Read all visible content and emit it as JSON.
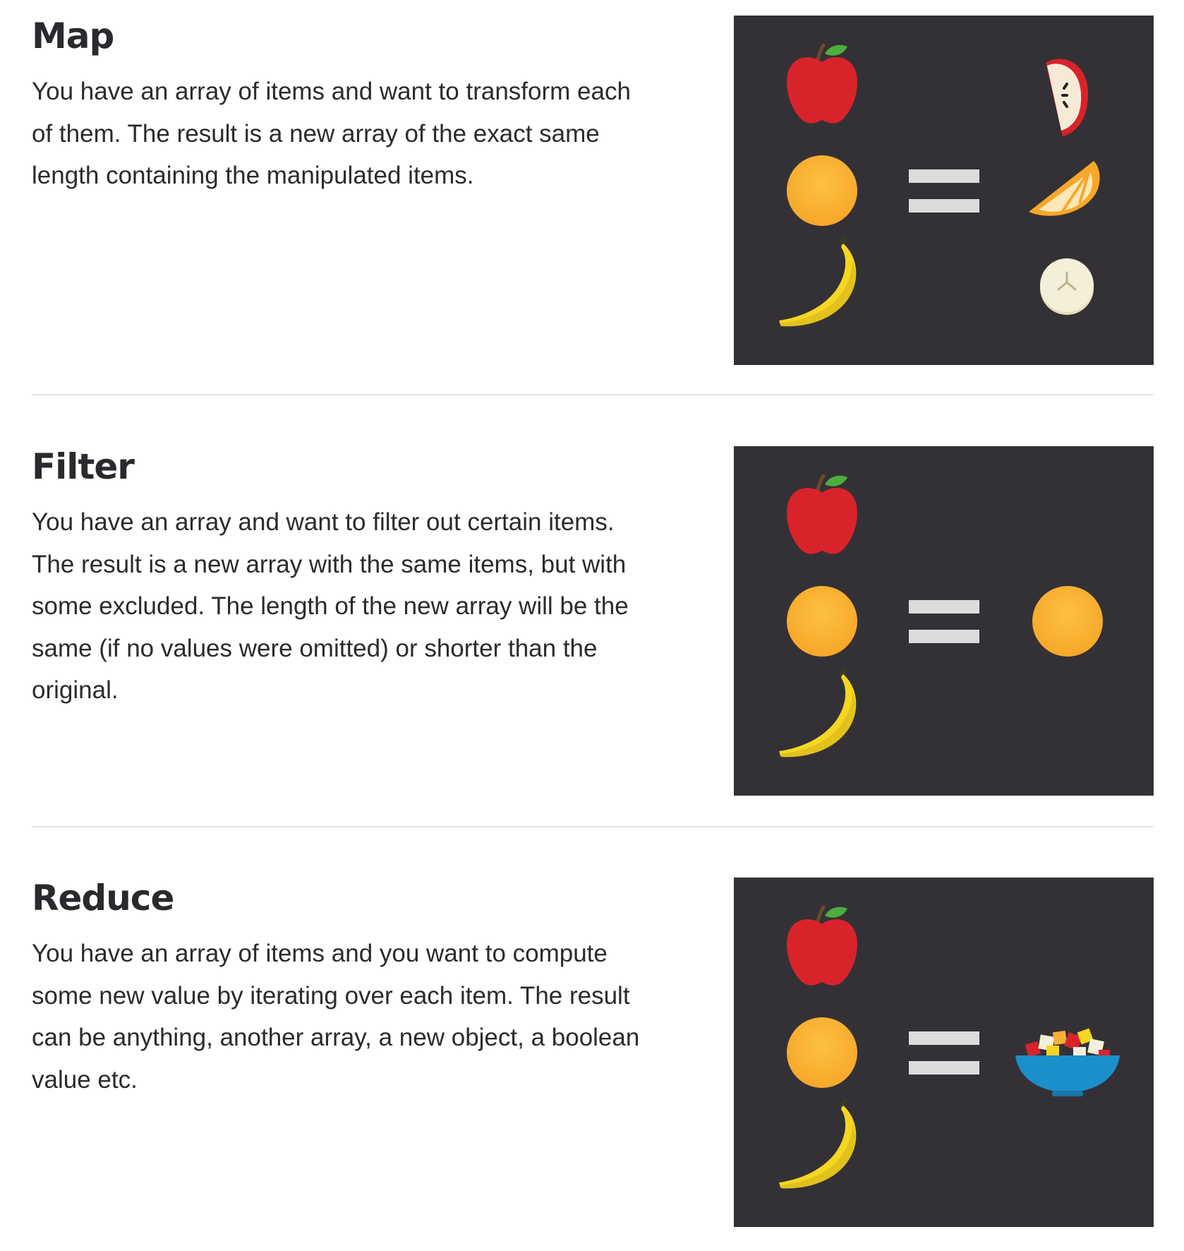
{
  "sections": [
    {
      "title": "Map",
      "description": "You have an array of items and want to transform each of them. The result is a new array of the exact same length containing the manipulated items.",
      "diagram": {
        "inputs": [
          "apple-icon",
          "orange-icon",
          "banana-icon"
        ],
        "operator": "equals-icon",
        "outputs": [
          "apple-slice-icon",
          "orange-wedge-icon",
          "banana-slice-icon"
        ]
      }
    },
    {
      "title": "Filter",
      "description": "You have an array and want to filter out certain items. The result is a new array with the same items, but with some excluded. The length of the new array will be the same (if no values were omitted) or shorter than the original.",
      "diagram": {
        "inputs": [
          "apple-icon",
          "orange-icon",
          "banana-icon"
        ],
        "operator": "equals-icon",
        "outputs": [
          "orange-icon"
        ]
      }
    },
    {
      "title": "Reduce",
      "description": "You have an array of items and you want to compute some new value by iterating over each item. The result can be anything, another array, a new object, a boolean value etc.",
      "diagram": {
        "inputs": [
          "apple-icon",
          "orange-icon",
          "banana-icon"
        ],
        "operator": "equals-icon",
        "outputs": [
          "fruit-salad-bowl-icon"
        ]
      }
    }
  ],
  "colors": {
    "panel_background": "#343136",
    "apple_red": "#d9232a",
    "orange": "#fbb034",
    "banana_yellow": "#f5d622",
    "equals_bars": "#dcdcdc",
    "bowl_blue": "#1b8fc9"
  }
}
